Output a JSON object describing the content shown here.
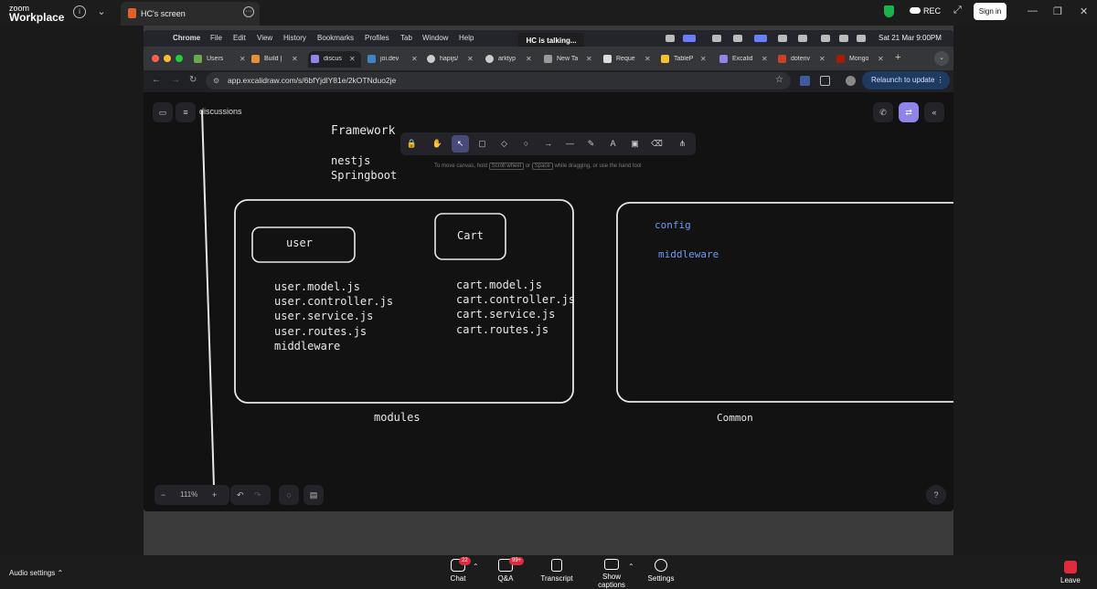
{
  "zoom": {
    "logo_line1": "zoom",
    "logo_line2": "Workplace",
    "screen_tab_title": "HC's screen",
    "rec_label": "REC",
    "signin_label": "Sign in",
    "bottom": {
      "audio_settings": "Audio settings",
      "chat": "Chat",
      "chat_badge": "22",
      "qa": "Q&A",
      "qa_badge": "99+",
      "transcript": "Transcript",
      "captions": "Show captions",
      "settings": "Settings",
      "leave": "Leave"
    }
  },
  "mac": {
    "menu": [
      "Chrome",
      "File",
      "Edit",
      "View",
      "History",
      "Bookmarks",
      "Profiles",
      "Tab",
      "Window",
      "Help"
    ],
    "talking": "HC is talking...",
    "clock": "Sat 21 Mar  9:00PM"
  },
  "chrome": {
    "tabs": [
      "Users",
      "Build |",
      "discus",
      "joi.dev",
      "hapijs/",
      "arktyp",
      "New Ta",
      "Reque",
      "TableP",
      "Excalid",
      "dotenv",
      "Mongo"
    ],
    "active_tab_index": 2,
    "url": "app.excalidraw.com/s/6bfYjdlY81e/2kOTNduo2je",
    "relaunch": "Relaunch to update"
  },
  "excalidraw": {
    "title": "discussions",
    "hint": {
      "pre": "To move canvas, hold",
      "key1": "Scroll wheel",
      "mid": "or",
      "key2": "Space",
      "post": "while dragging, or use the hand tool"
    },
    "zoom_level": "111%",
    "drawing": {
      "framework": "Framework",
      "nest": "nestjs",
      "spring": "Springboot",
      "user_box": "user",
      "cart_box": "Cart",
      "user_files": [
        "user.model.js",
        "user.controller.js",
        "user.service.js",
        "user.routes.js",
        "middleware"
      ],
      "cart_files": [
        "cart.model.js",
        "cart.controller.js",
        "cart.service.js",
        "cart.routes.js"
      ],
      "modules": "modules",
      "common": "Common",
      "config": "config",
      "middleware": "middleware"
    }
  }
}
